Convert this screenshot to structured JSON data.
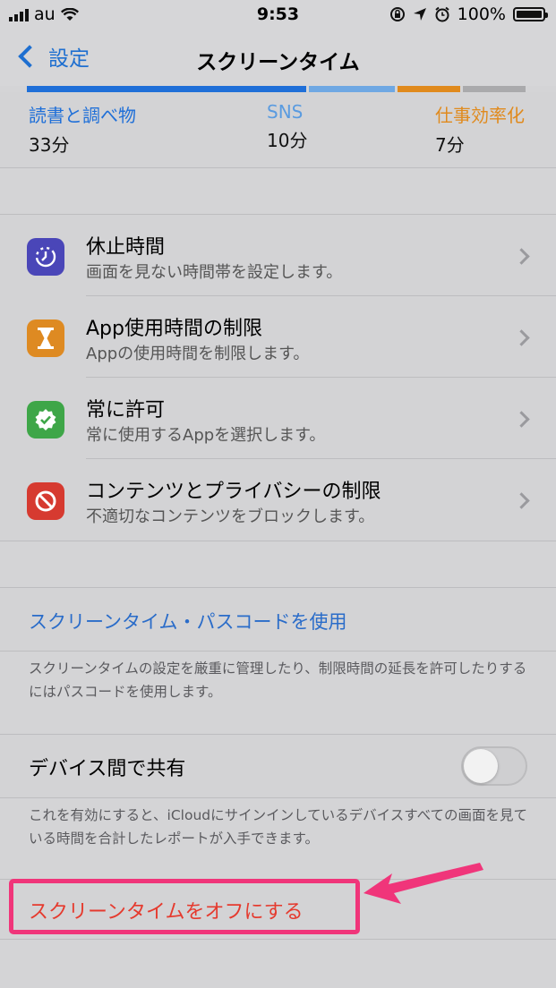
{
  "status_bar": {
    "carrier": "au",
    "time": "9:53",
    "battery": "100%"
  },
  "nav": {
    "back_label": "設定",
    "title": "スクリーンタイム"
  },
  "colors": {
    "blue": "#1f6fd8",
    "light_blue": "#6fa8e3",
    "orange": "#e08a1d",
    "gray": "#aaaaac",
    "link": "#2a6cc9",
    "red": "#e53a2e",
    "highlight": "#f0357a"
  },
  "usage": [
    {
      "category": "読書と調べ物",
      "minutes": "33分"
    },
    {
      "category": "SNS",
      "minutes": "10分"
    },
    {
      "category": "仕事効率化",
      "minutes": "7分"
    }
  ],
  "menu": [
    {
      "icon": "downtime-icon",
      "title": "休止時間",
      "subtitle": "画面を見ない時間帯を設定します。"
    },
    {
      "icon": "hourglass-icon",
      "title": "App使用時間の制限",
      "subtitle": "Appの使用時間を制限します。"
    },
    {
      "icon": "checkmark-badge-icon",
      "title": "常に許可",
      "subtitle": "常に使用するAppを選択します。"
    },
    {
      "icon": "restriction-icon",
      "title": "コンテンツとプライバシーの制限",
      "subtitle": "不適切なコンテンツをブロックします。"
    }
  ],
  "passcode": {
    "link": "スクリーンタイム・パスコードを使用",
    "note": "スクリーンタイムの設定を厳重に管理したり、制限時間の延長を許可したりするにはパスコードを使用します。"
  },
  "share": {
    "label": "デバイス間で共有",
    "note": "これを有効にすると、iCloudにサインインしているデバイスすべての画面を見ている時間を合計したレポートが入手できます。",
    "enabled": false
  },
  "turn_off": {
    "label": "スクリーンタイムをオフにする"
  }
}
